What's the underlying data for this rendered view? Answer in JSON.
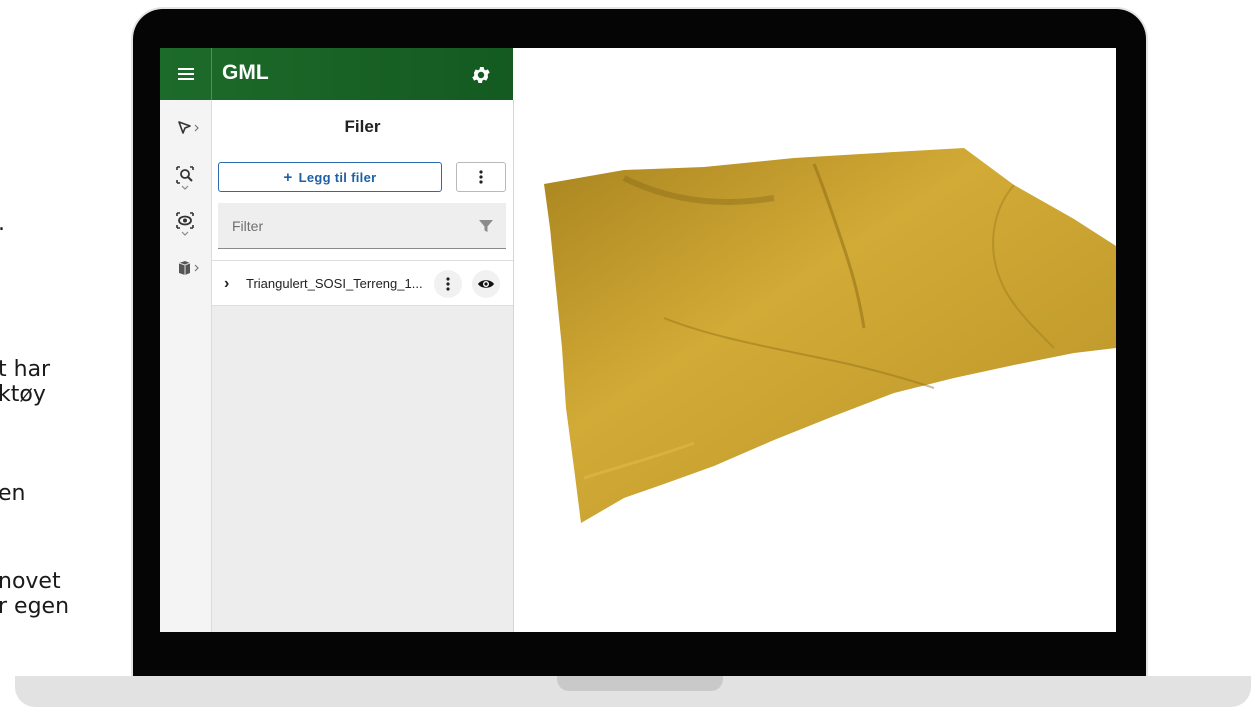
{
  "side_text": {
    "lines": [
      ".",
      "t har",
      "ktøy",
      "en",
      "novet",
      "r egen"
    ]
  },
  "app": {
    "title": "GML",
    "accent_color": "#1d6b2a",
    "icons": {
      "menu": "hamburger-menu-icon",
      "settings": "gear-icon"
    }
  },
  "rail": {
    "items": [
      "select-pointer-icon",
      "zoom-search-icon",
      "visibility-eye-icon",
      "layers-cube-icon"
    ]
  },
  "panel": {
    "title": "Filer",
    "add_button_label": "Legg til filer",
    "filter_placeholder": "Filter",
    "files": [
      {
        "name": "Triangulert_SOSI_Terreng_1..."
      }
    ]
  },
  "viewport": {
    "terrain_color": "#c9a232"
  }
}
